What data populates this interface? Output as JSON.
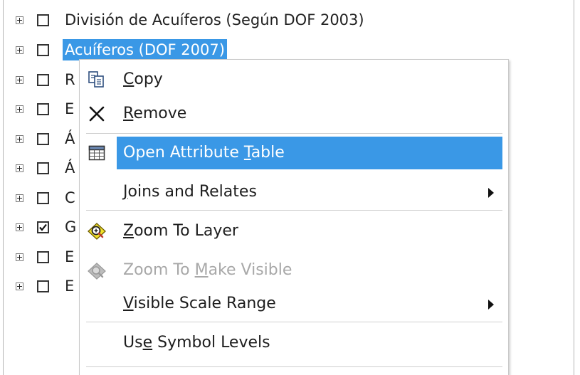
{
  "toc": {
    "layers": [
      {
        "label": "División de Acuíferos (Según DOF 2003)",
        "checked": false,
        "selected": false
      },
      {
        "label": "Acuíferos (DOF 2007)",
        "checked": false,
        "selected": true
      },
      {
        "label": "R",
        "checked": false,
        "selected": false
      },
      {
        "label": "E",
        "checked": false,
        "selected": false
      },
      {
        "label": "Á",
        "checked": false,
        "selected": false
      },
      {
        "label": "Á",
        "checked": false,
        "selected": false
      },
      {
        "label": "C",
        "checked": false,
        "selected": false
      },
      {
        "label": "G",
        "checked": true,
        "selected": false
      },
      {
        "label": "E",
        "checked": false,
        "selected": false
      },
      {
        "label": "E",
        "checked": false,
        "selected": false
      }
    ]
  },
  "context_menu": {
    "items": [
      {
        "pre": "",
        "key": "C",
        "post": "opy",
        "icon": "copy-icon",
        "enabled": true,
        "active": false,
        "submenu": false
      },
      {
        "pre": "",
        "key": "R",
        "post": "emove",
        "icon": "remove-icon",
        "enabled": true,
        "active": false,
        "submenu": false
      },
      {
        "pre": "Open Attribute ",
        "key": "T",
        "post": "able",
        "icon": "attribute-table-icon",
        "enabled": true,
        "active": true,
        "submenu": false
      },
      {
        "pre": "",
        "key": "J",
        "post": "oins and Relates",
        "icon": "",
        "enabled": true,
        "active": false,
        "submenu": true
      },
      {
        "pre": "",
        "key": "Z",
        "post": "oom To Layer",
        "icon": "zoom-to-layer-icon",
        "enabled": true,
        "active": false,
        "submenu": false
      },
      {
        "pre": "Zoom To ",
        "key": "M",
        "post": "ake Visible",
        "icon": "zoom-to-make-visible-icon",
        "enabled": false,
        "active": false,
        "submenu": false
      },
      {
        "pre": "",
        "key": "V",
        "post": "isible Scale Range",
        "icon": "",
        "enabled": true,
        "active": false,
        "submenu": true
      },
      {
        "pre": "Us",
        "key": "e",
        "post": " Symbol Levels",
        "icon": "",
        "enabled": true,
        "active": false,
        "submenu": false
      }
    ]
  },
  "colors": {
    "selection": "#3a98e6",
    "text": "#222222",
    "disabled_text": "#a8a8a8"
  }
}
